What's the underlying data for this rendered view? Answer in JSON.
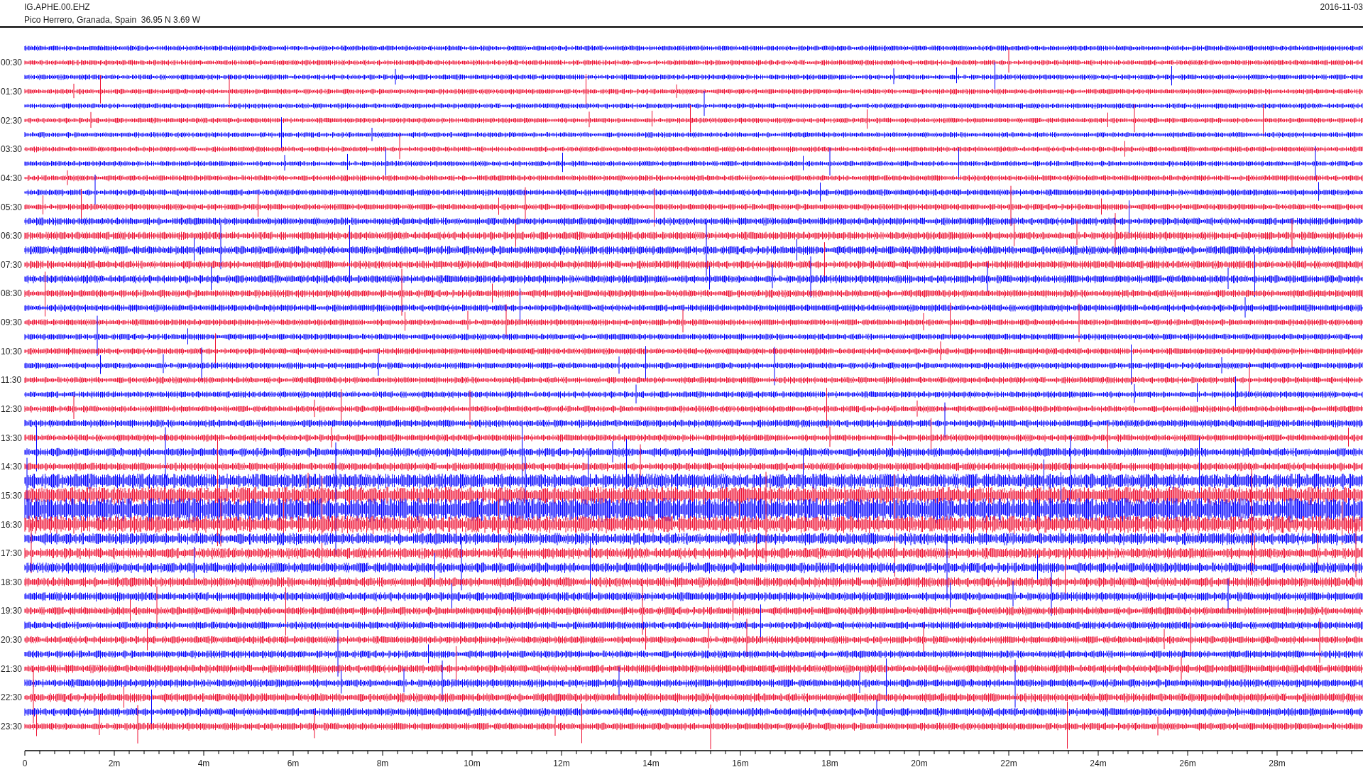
{
  "header": {
    "station": "IG.APHE.00.EHZ",
    "location": "Pico Herrero, Granada, Spain  36.95 N 3.69 W",
    "date": "2016-11-03"
  },
  "traces": [
    {
      "color": "#0000ff"
    },
    {
      "label": "00:30",
      "color": "#ee1133"
    },
    {
      "color": "#0000ff"
    },
    {
      "label": "01:30",
      "color": "#ee1133"
    },
    {
      "color": "#0000ff"
    },
    {
      "label": "02:30",
      "color": "#ee1133"
    },
    {
      "color": "#0000ff"
    },
    {
      "label": "03:30",
      "color": "#ee1133"
    },
    {
      "color": "#0000ff"
    },
    {
      "label": "04:30",
      "color": "#ee1133"
    },
    {
      "color": "#0000ff"
    },
    {
      "label": "05:30",
      "color": "#ee1133"
    },
    {
      "color": "#0000ff"
    },
    {
      "label": "06:30",
      "color": "#ee1133"
    },
    {
      "color": "#0000ff"
    },
    {
      "label": "07:30",
      "color": "#ee1133"
    },
    {
      "color": "#0000ff"
    },
    {
      "label": "08:30",
      "color": "#ee1133"
    },
    {
      "color": "#0000ff"
    },
    {
      "label": "09:30",
      "color": "#ee1133"
    },
    {
      "color": "#0000ff"
    },
    {
      "label": "10:30",
      "color": "#ee1133"
    },
    {
      "color": "#0000ff"
    },
    {
      "label": "11:30",
      "color": "#ee1133"
    },
    {
      "color": "#0000ff"
    },
    {
      "label": "12:30",
      "color": "#ee1133"
    },
    {
      "color": "#0000ff"
    },
    {
      "label": "13:30",
      "color": "#ee1133"
    },
    {
      "color": "#0000ff"
    },
    {
      "label": "14:30",
      "color": "#ee1133"
    },
    {
      "color": "#0000ff"
    },
    {
      "label": "15:30",
      "color": "#ee1133"
    },
    {
      "color": "#0000ff"
    },
    {
      "label": "16:30",
      "color": "#ee1133"
    },
    {
      "color": "#0000ff"
    },
    {
      "label": "17:30",
      "color": "#ee1133"
    },
    {
      "color": "#0000ff"
    },
    {
      "label": "18:30",
      "color": "#ee1133"
    },
    {
      "color": "#0000ff"
    },
    {
      "label": "19:30",
      "color": "#ee1133"
    },
    {
      "color": "#0000ff"
    },
    {
      "label": "20:30",
      "color": "#ee1133"
    },
    {
      "color": "#0000ff"
    },
    {
      "label": "21:30",
      "color": "#ee1133"
    },
    {
      "color": "#0000ff"
    },
    {
      "label": "22:30",
      "color": "#ee1133"
    },
    {
      "color": "#0000ff"
    },
    {
      "label": "23:30",
      "color": "#ee1133"
    }
  ],
  "x_axis": {
    "tick_labels": [
      "0",
      "2m",
      "4m",
      "6m",
      "8m",
      "10m",
      "12m",
      "14m",
      "16m",
      "18m",
      "20m",
      "22m",
      "24m",
      "26m",
      "28m"
    ]
  }
}
